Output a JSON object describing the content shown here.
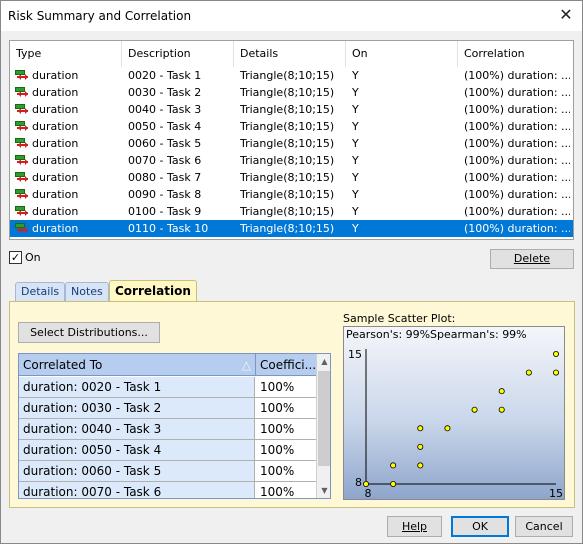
{
  "window": {
    "title": "Risk Summary and Correlation",
    "close_glyph": "✕"
  },
  "main_table": {
    "columns": [
      "Type",
      "Description",
      "Details",
      "On",
      "Correlation"
    ],
    "rows": [
      {
        "type": "duration",
        "description": "0020 - Task 1",
        "details": "Triangle(8;10;15)",
        "on": "Y",
        "correlation": "(100%) duration: ..."
      },
      {
        "type": "duration",
        "description": "0030 - Task 2",
        "details": "Triangle(8;10;15)",
        "on": "Y",
        "correlation": "(100%) duration: ..."
      },
      {
        "type": "duration",
        "description": "0040 - Task 3",
        "details": "Triangle(8;10;15)",
        "on": "Y",
        "correlation": "(100%) duration: ..."
      },
      {
        "type": "duration",
        "description": "0050 - Task 4",
        "details": "Triangle(8;10;15)",
        "on": "Y",
        "correlation": "(100%) duration: ..."
      },
      {
        "type": "duration",
        "description": "0060 - Task 5",
        "details": "Triangle(8;10;15)",
        "on": "Y",
        "correlation": "(100%) duration: ..."
      },
      {
        "type": "duration",
        "description": "0070 - Task 6",
        "details": "Triangle(8;10;15)",
        "on": "Y",
        "correlation": "(100%) duration: ..."
      },
      {
        "type": "duration",
        "description": "0080 - Task 7",
        "details": "Triangle(8;10;15)",
        "on": "Y",
        "correlation": "(100%) duration: ..."
      },
      {
        "type": "duration",
        "description": "0090 - Task 8",
        "details": "Triangle(8;10;15)",
        "on": "Y",
        "correlation": "(100%) duration: ..."
      },
      {
        "type": "duration",
        "description": "0100 - Task 9",
        "details": "Triangle(8;10;15)",
        "on": "Y",
        "correlation": "(100%) duration: ..."
      },
      {
        "type": "duration",
        "description": "0110 - Task 10",
        "details": "Triangle(8;10;15)",
        "on": "Y",
        "correlation": "(100%) duration: ..."
      }
    ],
    "selected_row": 9,
    "type_icon": "duration-range-icon"
  },
  "on_checkbox": {
    "label": "On",
    "checked": true,
    "mark": "✓"
  },
  "delete_button": {
    "label": "Delete"
  },
  "tabs": [
    {
      "label": "Details",
      "active": false
    },
    {
      "label": "Notes",
      "active": false
    },
    {
      "label": "Correlation",
      "active": true
    }
  ],
  "select_distributions_button": {
    "label": "Select Distributions..."
  },
  "corr_table": {
    "columns": [
      "Correlated To",
      "Coeffici..."
    ],
    "sort_icon": "sort-triangle-icon",
    "rows": [
      {
        "name": "duration: 0020 - Task 1",
        "value": "100%"
      },
      {
        "name": "duration: 0030 - Task 2",
        "value": "100%"
      },
      {
        "name": "duration: 0040 - Task 3",
        "value": "100%"
      },
      {
        "name": "duration: 0050 - Task 4",
        "value": "100%"
      },
      {
        "name": "duration: 0060 - Task 5",
        "value": "100%"
      },
      {
        "name": "duration: 0070 - Task 6",
        "value": "100%"
      }
    ]
  },
  "scatter": {
    "title": "Sample Scatter Plot:",
    "pearson": "Pearson's: 99%",
    "spearman": "Spearman's: 99%"
  },
  "chart_data": {
    "type": "scatter",
    "x": [
      8,
      9,
      9,
      10,
      10,
      10,
      11,
      12,
      13,
      13,
      14,
      15,
      15
    ],
    "y": [
      8,
      8,
      9,
      9,
      10,
      11,
      11,
      12,
      12,
      13,
      14,
      14,
      15
    ],
    "xlim": [
      8,
      15
    ],
    "ylim": [
      8,
      15
    ],
    "x_ticks": [
      "8",
      "15"
    ],
    "y_ticks": [
      "15",
      "8"
    ],
    "point_color": "#ffff00"
  },
  "footer": {
    "help_label": "Help",
    "ok_label": "OK",
    "cancel_label": "Cancel"
  },
  "colors": {
    "selection": "#0078d7",
    "tab_active": "#fff8c4",
    "panel": "#fff8d6"
  }
}
